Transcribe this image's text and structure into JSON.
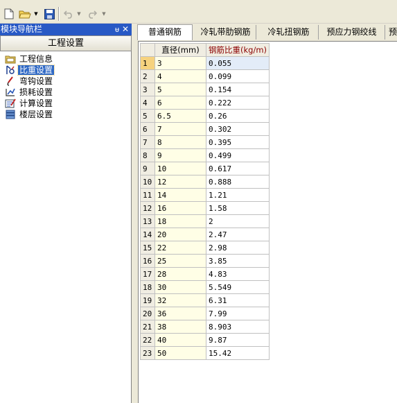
{
  "toolbar": {
    "buttons": [
      {
        "name": "new-file-icon",
        "enabled": true
      },
      {
        "name": "open-folder-icon",
        "enabled": true
      },
      {
        "name": "save-icon",
        "enabled": true
      },
      {
        "name": "undo-icon",
        "enabled": false
      },
      {
        "name": "redo-icon",
        "enabled": false
      }
    ]
  },
  "nav": {
    "header_title": "模块导航栏",
    "pin_glyph": "ᵾ",
    "close_glyph": "✕",
    "section_title": "工程设置",
    "items": [
      {
        "label": "工程信息",
        "icon": "project-info-icon",
        "selected": false
      },
      {
        "label": "比重设置",
        "icon": "density-settings-icon",
        "selected": true
      },
      {
        "label": "弯钩设置",
        "icon": "hook-settings-icon",
        "selected": false
      },
      {
        "label": "损耗设置",
        "icon": "loss-settings-icon",
        "selected": false
      },
      {
        "label": "计算设置",
        "icon": "calc-settings-icon",
        "selected": false
      },
      {
        "label": "楼层设置",
        "icon": "floor-settings-icon",
        "selected": false
      }
    ]
  },
  "tabs": [
    {
      "label": "普通钢筋",
      "active": true
    },
    {
      "label": "冷轧带肋钢筋",
      "active": false
    },
    {
      "label": "冷轧扭钢筋",
      "active": false
    },
    {
      "label": "预应力钢绞线",
      "active": false
    },
    {
      "label": "预",
      "active": false
    }
  ],
  "grid": {
    "col_diameter": "直径(mm)",
    "col_weight": "钢筋比重(kg/m)",
    "rows": [
      {
        "n": "1",
        "d": "3",
        "w": "0.055"
      },
      {
        "n": "2",
        "d": "4",
        "w": "0.099"
      },
      {
        "n": "3",
        "d": "5",
        "w": "0.154"
      },
      {
        "n": "4",
        "d": "6",
        "w": "0.222"
      },
      {
        "n": "5",
        "d": "6.5",
        "w": "0.26"
      },
      {
        "n": "6",
        "d": "7",
        "w": "0.302"
      },
      {
        "n": "7",
        "d": "8",
        "w": "0.395"
      },
      {
        "n": "8",
        "d": "9",
        "w": "0.499"
      },
      {
        "n": "9",
        "d": "10",
        "w": "0.617"
      },
      {
        "n": "10",
        "d": "12",
        "w": "0.888"
      },
      {
        "n": "11",
        "d": "14",
        "w": "1.21"
      },
      {
        "n": "12",
        "d": "16",
        "w": "1.58"
      },
      {
        "n": "13",
        "d": "18",
        "w": "2"
      },
      {
        "n": "14",
        "d": "20",
        "w": "2.47"
      },
      {
        "n": "15",
        "d": "22",
        "w": "2.98"
      },
      {
        "n": "16",
        "d": "25",
        "w": "3.85"
      },
      {
        "n": "17",
        "d": "28",
        "w": "4.83"
      },
      {
        "n": "18",
        "d": "30",
        "w": "5.549"
      },
      {
        "n": "19",
        "d": "32",
        "w": "6.31"
      },
      {
        "n": "20",
        "d": "36",
        "w": "7.99"
      },
      {
        "n": "21",
        "d": "38",
        "w": "8.903"
      },
      {
        "n": "22",
        "d": "40",
        "w": "9.87"
      },
      {
        "n": "23",
        "d": "50",
        "w": "15.42"
      }
    ],
    "selected_row": 0
  }
}
